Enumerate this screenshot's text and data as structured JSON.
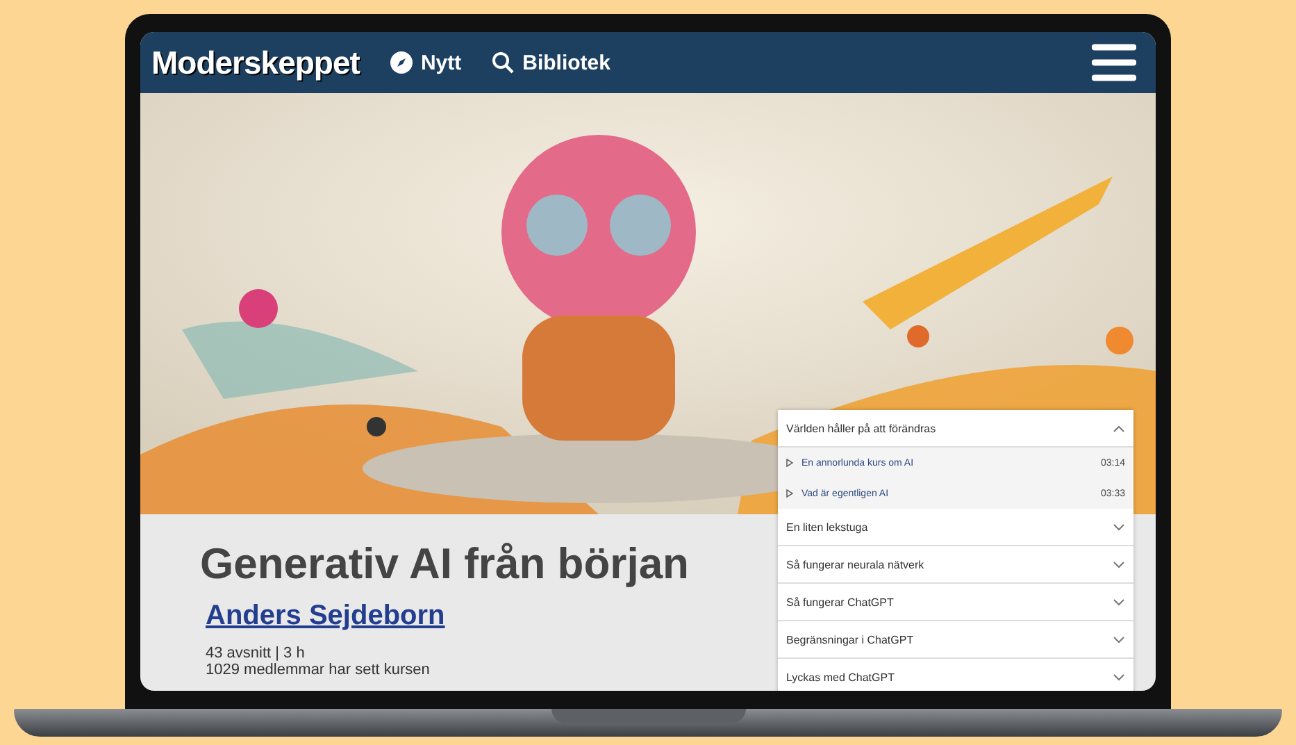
{
  "header": {
    "logo": "Moderskeppet",
    "nav": [
      {
        "kind": "compass",
        "label": "Nytt"
      },
      {
        "kind": "search",
        "label": "Bibliotek"
      }
    ]
  },
  "course": {
    "title": "Generativ AI från början",
    "author": "Anders Sejdeborn",
    "meta": "43 avsnitt | 3 h",
    "viewers": "1029 medlemmar har sett kursen"
  },
  "chapters": [
    {
      "title": "Världen håller på att förändras",
      "expanded": true,
      "episodes": [
        {
          "title": "En annorlunda kurs om AI",
          "duration": "03:14"
        },
        {
          "title": "Vad är egentligen AI",
          "duration": "03:33"
        }
      ]
    },
    {
      "title": "En liten lekstuga",
      "expanded": false
    },
    {
      "title": "Så fungerar neurala nätverk",
      "expanded": false
    },
    {
      "title": "Så fungerar ChatGPT",
      "expanded": false
    },
    {
      "title": "Begränsningar i ChatGPT",
      "expanded": false
    },
    {
      "title": "Lyckas med ChatGPT",
      "expanded": false
    }
  ]
}
